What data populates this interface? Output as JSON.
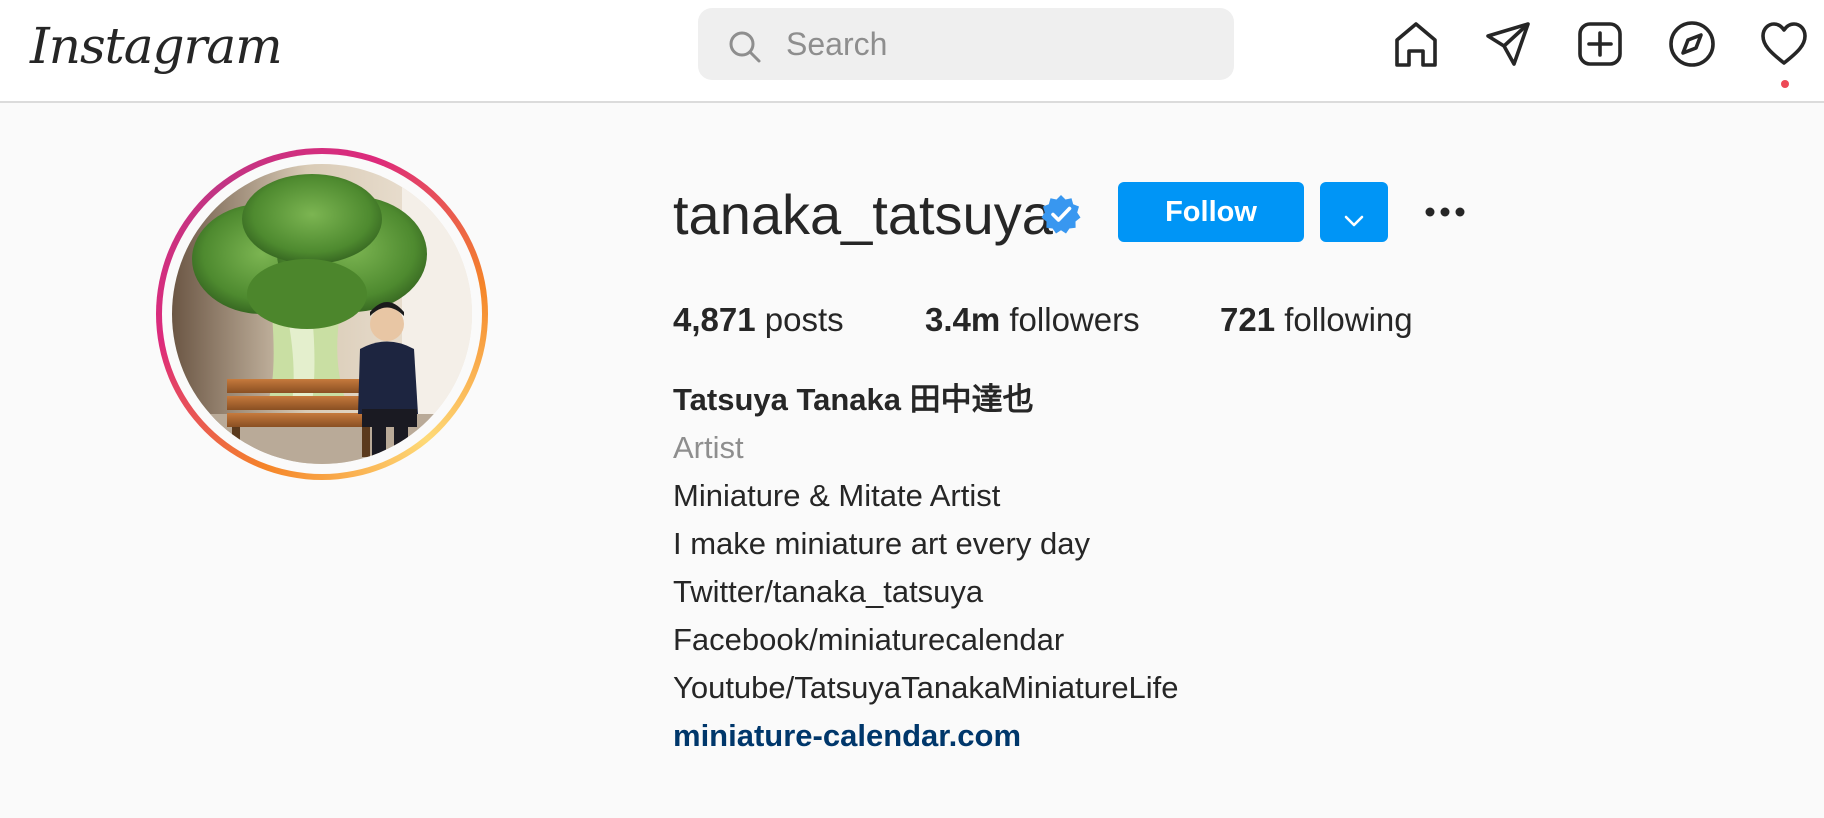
{
  "header": {
    "logo_text": "Instagram",
    "search": {
      "placeholder": "Search",
      "value": ""
    },
    "icons": [
      "home-icon",
      "direct-message-icon",
      "new-post-icon",
      "explore-icon",
      "activity-heart-icon"
    ],
    "notification_dot_color": "#ed4956"
  },
  "profile": {
    "username": "tanaka_tatsuya",
    "verified": true,
    "follow_label": "Follow",
    "accent_color": "#0095f6",
    "stats": {
      "posts_count": "4,871",
      "posts_label": "posts",
      "followers_count": "3.4m",
      "followers_label": "followers",
      "following_count": "721",
      "following_label": "following"
    },
    "bio": {
      "full_name": "Tatsuya Tanaka 田中達也",
      "category": "Artist",
      "lines": [
        "Miniature & Mitate Artist",
        "I make miniature art every day",
        "Twitter/tanaka_tatsuya",
        "Facebook/miniaturecalendar",
        "Youtube/TatsuyaTanakaMiniatureLife"
      ],
      "website": "miniature-calendar.com",
      "link_color": "#00376b"
    }
  }
}
